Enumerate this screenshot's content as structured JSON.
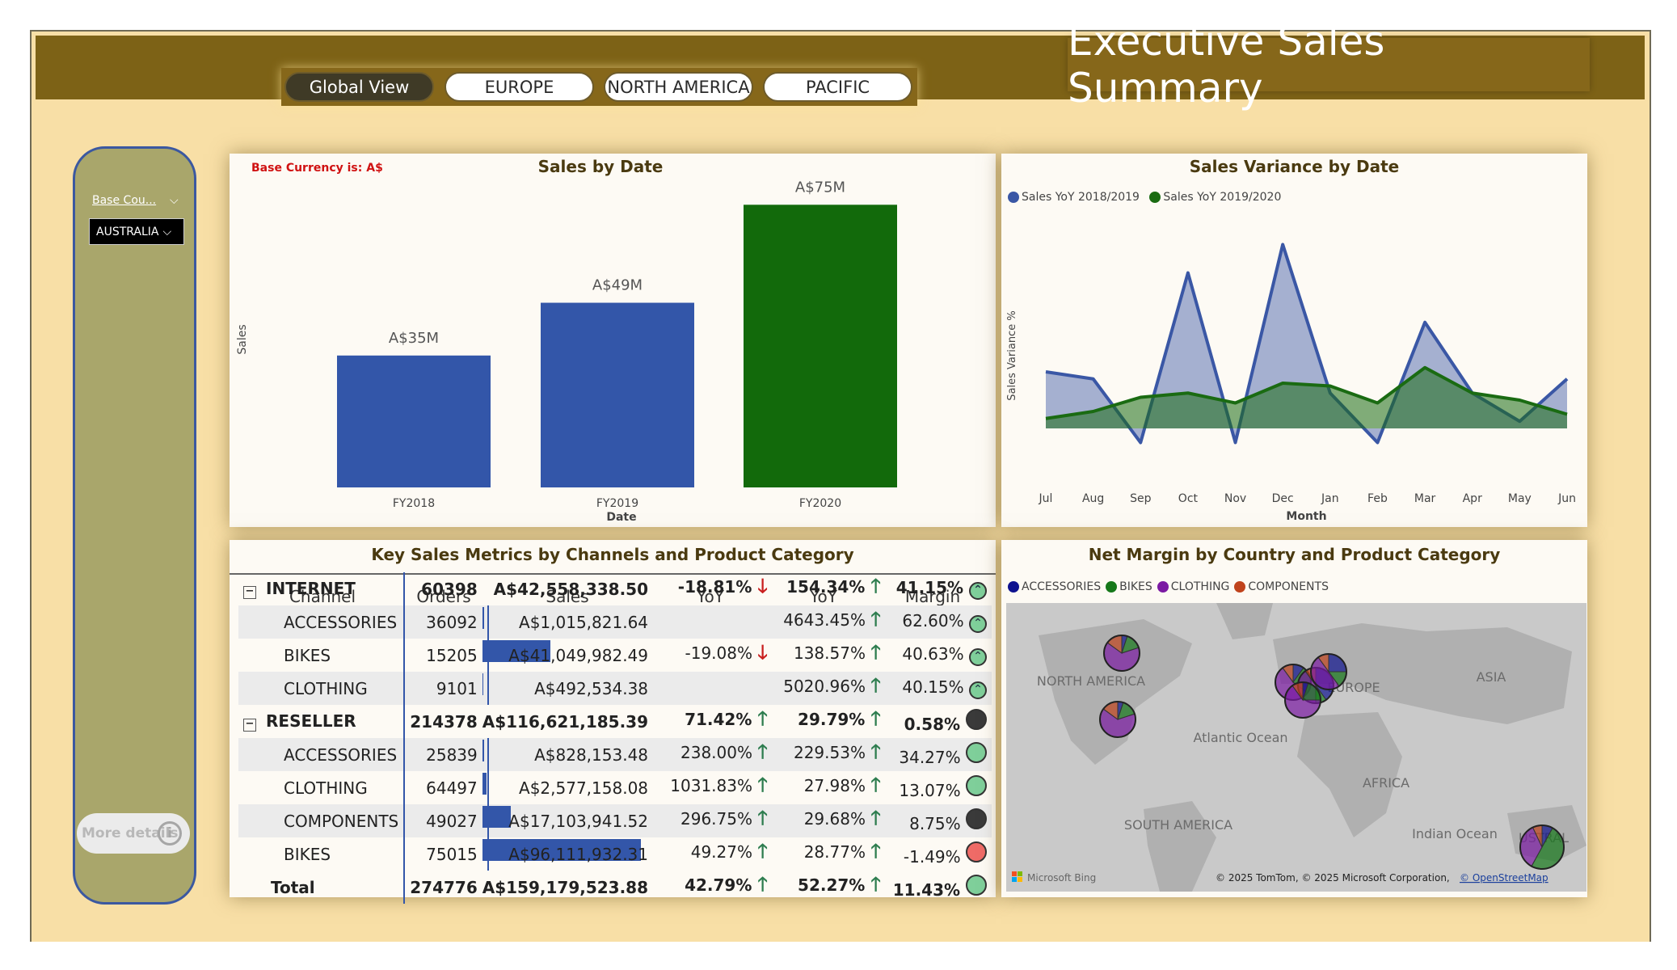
{
  "report": {
    "title": "Executive Sales Summary",
    "nav": [
      "Global View",
      "EUROPE",
      "NORTH AMERICA",
      "PACIFIC"
    ],
    "active_nav": "Global View"
  },
  "sidebar": {
    "filter_label": "Base Cou...",
    "filter_value": "AUSTRALIA",
    "more_label": "More details"
  },
  "sales_by_date": {
    "note": "Base Currency is: A$",
    "chart_data": {
      "type": "bar",
      "title": "Sales by Date",
      "xlabel": "Date",
      "ylabel": "Sales",
      "categories": [
        "FY2018",
        "FY2019",
        "FY2020"
      ],
      "values": [
        35,
        49,
        75
      ],
      "data_labels": [
        "A$35M",
        "A$49M",
        "A$75M"
      ],
      "colors": [
        "#3356a9",
        "#3356a9",
        "#126a0b"
      ],
      "ylim": [
        0,
        80
      ]
    }
  },
  "sales_variance": {
    "chart_data": {
      "type": "area",
      "title": "Sales Variance by Date",
      "xlabel": "Month",
      "ylabel": "Sales Variance %",
      "categories": [
        "Jul",
        "Aug",
        "Sep",
        "Oct",
        "Nov",
        "Dec",
        "Jan",
        "Feb",
        "Mar",
        "Apr",
        "May",
        "Jun"
      ],
      "series": [
        {
          "name": "Sales YoY 2018/2019",
          "color": "#3a57a5",
          "values": [
            40,
            35,
            -10,
            110,
            -10,
            130,
            25,
            -10,
            75,
            25,
            5,
            35
          ]
        },
        {
          "name": "Sales YoY 2019/2020",
          "color": "#1a6b12",
          "values": [
            7,
            12,
            22,
            25,
            18,
            32,
            30,
            18,
            43,
            25,
            20,
            10
          ]
        }
      ],
      "ylim": [
        -20,
        140
      ]
    }
  },
  "metrics": {
    "title": "Key Sales Metrics by Channels and Product Category",
    "headers": [
      "Channel",
      "Orders",
      "Sales",
      "YoY\n2018/2019",
      "YoY\n2019/2020",
      "Margin"
    ],
    "rows": [
      {
        "label": "INTERNET",
        "group": true,
        "orders": "60398",
        "sales": "A$42,558,338.50",
        "yoy1": "-18.81%",
        "yoy1_dir": "down",
        "yoy2": "154.34%",
        "yoy2_dir": "up",
        "margin": "41.15%",
        "kpi": "up",
        "bar": 0
      },
      {
        "label": "ACCESSORIES",
        "group": false,
        "orders": "36092",
        "sales": "A$1,015,821.64",
        "yoy1": "",
        "yoy1_dir": "",
        "yoy2": "4643.45%",
        "yoy2_dir": "up",
        "margin": "62.60%",
        "kpi": "up",
        "bar": 0.01
      },
      {
        "label": "BIKES",
        "group": false,
        "orders": "15205",
        "sales": "A$41,049,982.49",
        "yoy1": "-19.08%",
        "yoy1_dir": "down",
        "yoy2": "138.57%",
        "yoy2_dir": "up",
        "margin": "40.63%",
        "kpi": "up",
        "bar": 0.43
      },
      {
        "label": "CLOTHING",
        "group": false,
        "orders": "9101",
        "sales": "A$492,534.38",
        "yoy1": "",
        "yoy1_dir": "",
        "yoy2": "5020.96%",
        "yoy2_dir": "up",
        "margin": "40.15%",
        "kpi": "up",
        "bar": 0.005
      },
      {
        "label": "RESELLER",
        "group": true,
        "orders": "214378",
        "sales": "A$116,621,185.39",
        "yoy1": "71.42%",
        "yoy1_dir": "up",
        "yoy2": "29.79%",
        "yoy2_dir": "up",
        "margin": "0.58%",
        "kpi": "dark",
        "bar": 0
      },
      {
        "label": "ACCESSORIES",
        "group": false,
        "orders": "25839",
        "sales": "A$828,153.48",
        "yoy1": "238.00%",
        "yoy1_dir": "up",
        "yoy2": "229.53%",
        "yoy2_dir": "up",
        "margin": "34.27%",
        "kpi": "green",
        "bar": 0.008
      },
      {
        "label": "CLOTHING",
        "group": false,
        "orders": "64497",
        "sales": "A$2,577,158.08",
        "yoy1": "1031.83%",
        "yoy1_dir": "up",
        "yoy2": "27.98%",
        "yoy2_dir": "up",
        "margin": "13.07%",
        "kpi": "green",
        "bar": 0.027
      },
      {
        "label": "COMPONENTS",
        "group": false,
        "orders": "49027",
        "sales": "A$17,103,941.52",
        "yoy1": "296.75%",
        "yoy1_dir": "up",
        "yoy2": "29.68%",
        "yoy2_dir": "up",
        "margin": "8.75%",
        "kpi": "dark",
        "bar": 0.18
      },
      {
        "label": "BIKES",
        "group": false,
        "orders": "75015",
        "sales": "A$96,111,932.31",
        "yoy1": "49.27%",
        "yoy1_dir": "up",
        "yoy2": "28.77%",
        "yoy2_dir": "up",
        "margin": "-1.49%",
        "kpi": "red",
        "bar": 1.0
      },
      {
        "label": "Total",
        "group": "total",
        "orders": "274776",
        "sales": "A$159,179,523.88",
        "yoy1": "42.79%",
        "yoy1_dir": "up",
        "yoy2": "52.27%",
        "yoy2_dir": "up",
        "margin": "11.43%",
        "kpi": "green",
        "bar": 0
      }
    ]
  },
  "net_margin": {
    "title": "Net Margin by Country and Product Category",
    "legend": [
      {
        "name": "ACCESSORIES",
        "color": "#0e128f"
      },
      {
        "name": "BIKES",
        "color": "#16781a"
      },
      {
        "name": "CLOTHING",
        "color": "#7b1aa3"
      },
      {
        "name": "COMPONENTS",
        "color": "#c0431c"
      }
    ],
    "map_labels": [
      "NORTH AMERICA",
      "EUROPE",
      "ASIA",
      "Atlantic Ocean",
      "AFRICA",
      "SOUTH AMERICA",
      "Indian Ocean",
      "USTRAL"
    ],
    "attribution": "© 2025 TomTom, © 2025 Microsoft Corporation,",
    "attribution_link": "© OpenStreetMap",
    "brand": "Microsoft Bing"
  }
}
